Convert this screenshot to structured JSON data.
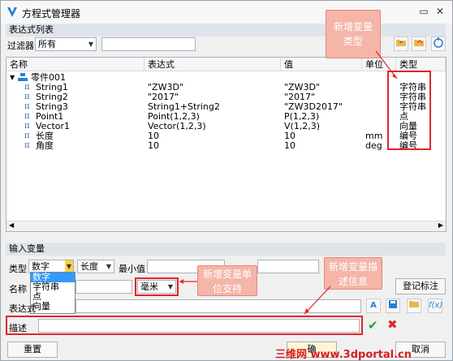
{
  "window": {
    "title": "方程式管理器"
  },
  "expr_section": {
    "header": "表达式列表",
    "filter_label": "过滤器",
    "filter_value": "所有",
    "search_value": ""
  },
  "table": {
    "columns": [
      "名称",
      "表达式",
      "值",
      "单位",
      "类型"
    ],
    "group": "零件001",
    "rows": [
      {
        "name": "String1",
        "expr": "\"ZW3D\"",
        "value": "\"ZW3D\"",
        "unit": "",
        "type": "字符串"
      },
      {
        "name": "String2",
        "expr": "\"2017\"",
        "value": "\"2017\"",
        "unit": "",
        "type": "字符串"
      },
      {
        "name": "String3",
        "expr": "String1+String2",
        "value": "\"ZW3D2017\"",
        "unit": "",
        "type": "字符串"
      },
      {
        "name": "Point1",
        "expr": "Point(1,2,3)",
        "value": "P(1,2,3)",
        "unit": "",
        "type": "点"
      },
      {
        "name": "Vector1",
        "expr": "Vector(1,2,3)",
        "value": "V(1,2,3)",
        "unit": "",
        "type": "向量"
      },
      {
        "name": "长度",
        "expr": "10",
        "value": "10",
        "unit": "mm",
        "type": "编号"
      },
      {
        "name": "角度",
        "expr": "10",
        "value": "10",
        "unit": "deg",
        "type": "编号"
      }
    ]
  },
  "input_section": {
    "header": "输入变量",
    "type_label": "类型",
    "type_value": "数字",
    "subtype_value": "长度",
    "min_label": "最小值",
    "name_label": "名称",
    "unit_value": "毫米",
    "expr_label": "表达式",
    "desc_label": "描述",
    "register_button": "登记标注",
    "type_options": [
      "数字",
      "字符串",
      "点",
      "向量"
    ]
  },
  "buttons": {
    "reset": "重置",
    "ok_partial": "确",
    "cancel_partial": "取消"
  },
  "callouts": {
    "type": "新增变量类型",
    "unit": "新增变量单位支持",
    "desc": "新增变量描述信息"
  },
  "watermark": "三维网 www.3dportal.cn"
}
